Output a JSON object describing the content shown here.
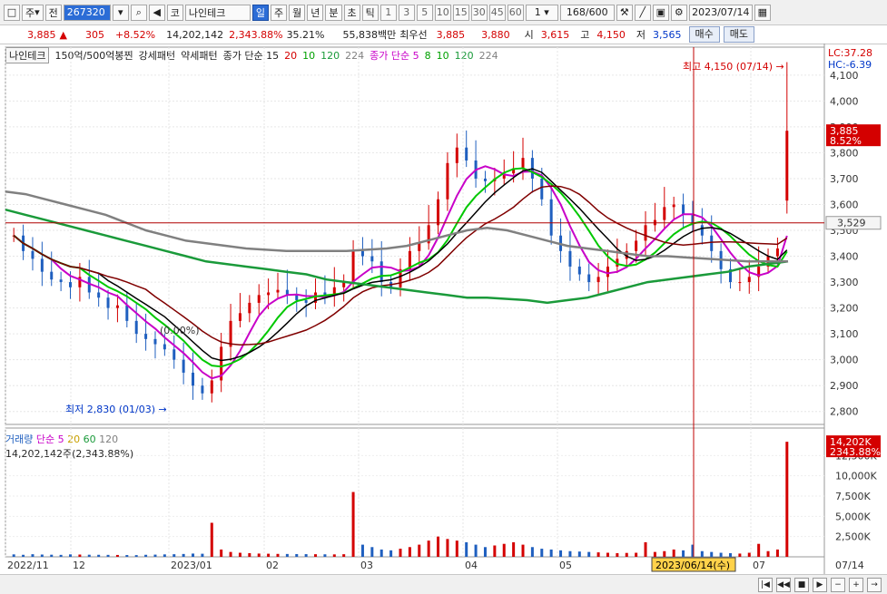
{
  "toolbar": {
    "type_label": "주",
    "prev_label": "전",
    "code": "267320",
    "market_label": "코",
    "stock_name": "나인테크",
    "periods": [
      "일",
      "주",
      "월",
      "년",
      "분",
      "초",
      "틱"
    ],
    "selected_period": "일",
    "intervals": [
      "1",
      "3",
      "5",
      "10",
      "15",
      "30",
      "45",
      "60"
    ],
    "interval_value": "1",
    "count": "168",
    "count_total": "/600",
    "date": "2023/07/14"
  },
  "info": {
    "price": "3,885",
    "arrow": "▲",
    "change": "305",
    "change_pct": "+8.52%",
    "volume": "14,202,142",
    "volume_pct": "2,343.88%",
    "turnover": "35.21%",
    "amount": "55,838백만",
    "best_bid_label": "최우선",
    "best_bid": "3,885",
    "best_ask": "3,880",
    "open_label": "시",
    "open": "3,615",
    "high_label": "고",
    "high": "4,150",
    "low_label": "저",
    "low": "3,565",
    "buy_label": "매수",
    "sell_label": "매도"
  },
  "legend": {
    "name_tag": "나인테크",
    "pattern1": "150억/500억봉찐",
    "pattern2": "강세패턴",
    "pattern3": "약세패턴",
    "ma_label": "종가 단순 15",
    "ma_periods": [
      "20",
      "10",
      "120",
      "224"
    ],
    "ma2_label": "종가 단순 5",
    "ma2_periods": [
      "8",
      "10",
      "120",
      "224"
    ]
  },
  "volume_legend": {
    "title": "거래량",
    "ma_label": "단순 5",
    "ma_periods": [
      "20",
      "60",
      "120"
    ],
    "summary": "14,202,142주(2,343.88%)"
  },
  "colors": {
    "up": "#d40000",
    "down": "#1f5fbf",
    "ma5": "#c800c8",
    "ma8": "#00c800",
    "ma10": "#000000",
    "ma15": "#800000",
    "ma120": "#1a9a3a",
    "ma224": "#808080",
    "hline": "#b00000"
  },
  "chart_data": [
    {
      "type": "candlestick",
      "title": "",
      "y_ticks": [
        4100,
        4000,
        3900,
        3800,
        3700,
        3600,
        3500,
        3400,
        3300,
        3200,
        3100,
        3000,
        2900,
        2800
      ],
      "ylim": [
        2750,
        4180
      ],
      "x_labels": [
        "2022/11",
        "12",
        "2023/01",
        "02",
        "03",
        "04",
        "05",
        "07",
        "07/14"
      ],
      "hover_date_label": "2023/06/14(수)",
      "high_annotation": "최고 4,150 (07/14)",
      "low_annotation": "최저 2,830 (01/03)",
      "mid_annotation": "(0.00%)",
      "current_price_label": "3,885",
      "current_pct_label": "8.52%",
      "hline_label": "3,529",
      "lc_label": "LC:37.28",
      "hc_label": "HC:-6.39",
      "series_points": [
        [
          3480,
          3420,
          3390,
          3340,
          3310,
          3300,
          3280,
          3320,
          3260,
          3240,
          3200,
          3210,
          3150,
          3100,
          3080,
          3060,
          3040,
          3000,
          2950,
          2900,
          2870,
          2920,
          3050,
          3150,
          3180,
          3220,
          3250,
          3260,
          3270,
          3250,
          3230,
          3220,
          3260,
          3250,
          3280,
          3300,
          3420,
          3400,
          3380,
          3300,
          3280,
          3350,
          3420,
          3450,
          3520,
          3620,
          3760,
          3820,
          3770,
          3700,
          3690,
          3700,
          3720,
          3740,
          3780,
          3700,
          3620,
          3480,
          3420,
          3360,
          3330,
          3300,
          3320,
          3360,
          3390,
          3420,
          3460,
          3520,
          3540,
          3590,
          3600,
          3560,
          3520,
          3480,
          3420,
          3350,
          3300,
          3300,
          3320,
          3360,
          3400,
          3430,
          3885
        ]
      ],
      "close_values": [
        3480,
        3420,
        3390,
        3340,
        3310,
        3300,
        3280,
        3320,
        3260,
        3240,
        3200,
        3210,
        3150,
        3100,
        3080,
        3060,
        3040,
        3000,
        2950,
        2900,
        2870,
        2920,
        3050,
        3150,
        3180,
        3220,
        3250,
        3260,
        3270,
        3250,
        3230,
        3220,
        3260,
        3250,
        3280,
        3300,
        3420,
        3400,
        3380,
        3300,
        3280,
        3350,
        3420,
        3450,
        3520,
        3620,
        3760,
        3820,
        3770,
        3700,
        3690,
        3700,
        3720,
        3740,
        3780,
        3700,
        3620,
        3480,
        3420,
        3360,
        3330,
        3300,
        3320,
        3360,
        3390,
        3420,
        3460,
        3520,
        3540,
        3590,
        3600,
        3560,
        3520,
        3480,
        3420,
        3350,
        3300,
        3300,
        3320,
        3360,
        3400,
        3430,
        3885
      ],
      "ma120_values": [
        3580,
        3560,
        3540,
        3520,
        3500,
        3480,
        3460,
        3440,
        3420,
        3400,
        3380,
        3370,
        3360,
        3350,
        3340,
        3330,
        3310,
        3300,
        3290,
        3280,
        3270,
        3260,
        3250,
        3240,
        3240,
        3235,
        3230,
        3220,
        3230,
        3240,
        3260,
        3280,
        3300,
        3310,
        3320,
        3330,
        3340,
        3360,
        3370,
        3380
      ],
      "ma224_values": [
        3650,
        3640,
        3620,
        3600,
        3580,
        3560,
        3530,
        3500,
        3480,
        3460,
        3450,
        3440,
        3430,
        3425,
        3420,
        3420,
        3420,
        3420,
        3425,
        3430,
        3440,
        3460,
        3480,
        3500,
        3510,
        3500,
        3480,
        3460,
        3440,
        3430,
        3420,
        3410,
        3400,
        3400,
        3395,
        3390,
        3385,
        3380,
        3380,
        3380
      ]
    },
    {
      "type": "bar",
      "title": "",
      "y_ticks": [
        "12,500K",
        "10,000K",
        "7,500K",
        "5,000K",
        "2,500K"
      ],
      "last_label": "14,202K",
      "last_pct_label": "2343.88%",
      "values": [
        300,
        250,
        320,
        280,
        260,
        240,
        300,
        280,
        260,
        250,
        240,
        230,
        220,
        210,
        250,
        270,
        300,
        320,
        350,
        400,
        380,
        4200,
        900,
        600,
        500,
        450,
        400,
        380,
        360,
        350,
        340,
        330,
        320,
        310,
        300,
        320,
        8000,
        1500,
        1200,
        900,
        800,
        1000,
        1200,
        1500,
        2000,
        2500,
        2200,
        2000,
        1800,
        1500,
        1200,
        1400,
        1600,
        1800,
        1500,
        1200,
        1000,
        900,
        800,
        700,
        650,
        600,
        550,
        500,
        450,
        480,
        500,
        1800,
        600,
        700,
        900,
        800,
        1500,
        700,
        600,
        500,
        450,
        400,
        500,
        1600,
        700,
        900,
        14202
      ]
    }
  ]
}
